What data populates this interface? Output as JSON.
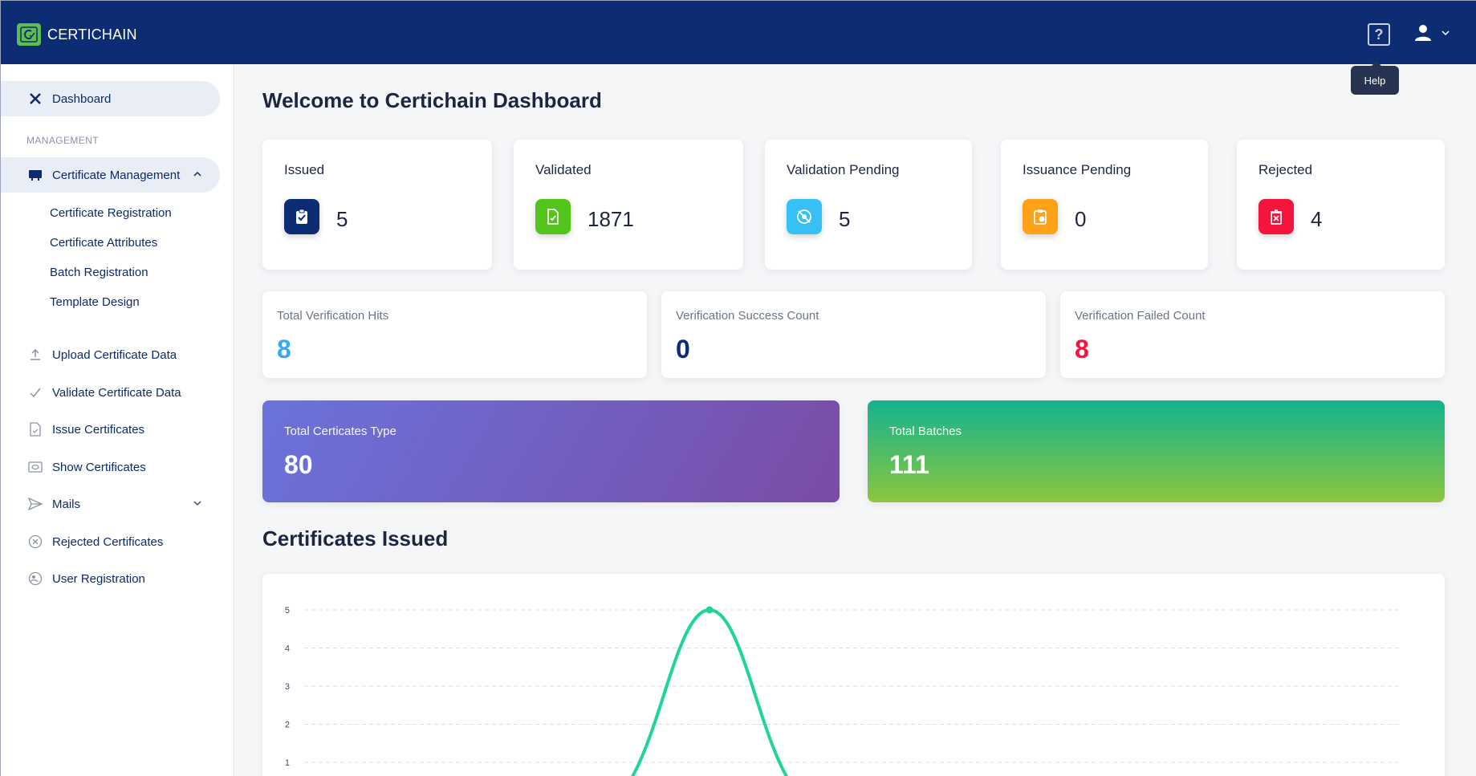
{
  "app": {
    "name": "CERTICHAIN",
    "help_tooltip": "Help",
    "help_glyph": "?"
  },
  "sidebar": {
    "dashboard": "Dashboard",
    "section_label": "MANAGEMENT",
    "cert_management": "Certificate Management",
    "sub_items": [
      "Certificate Registration",
      "Certificate Attributes",
      "Batch Registration",
      "Template Design"
    ],
    "items": [
      "Upload Certificate Data",
      "Validate Certificate Data",
      "Issue Certificates",
      "Show Certificates",
      "Mails",
      "Rejected Certificates",
      "User Registration"
    ]
  },
  "main": {
    "title": "Welcome to Certichain Dashboard",
    "stats": [
      {
        "label": "Issued",
        "value": "5",
        "color": "#0c2d74",
        "icon": "clipboard-check-icon"
      },
      {
        "label": "Validated",
        "value": "1871",
        "color": "#52c41a",
        "icon": "document-check-icon"
      },
      {
        "label": "Validation Pending",
        "value": "5",
        "color": "#36c0f5",
        "icon": "eye-off-icon"
      },
      {
        "label": "Issuance Pending",
        "value": "0",
        "color": "#ffa21a",
        "icon": "clipboard-clock-icon"
      },
      {
        "label": "Rejected",
        "value": "4",
        "color": "#f5153c",
        "icon": "trash-x-icon"
      }
    ],
    "verification": [
      {
        "label": "Total Verification Hits",
        "value": "8",
        "color": "#36a9f5"
      },
      {
        "label": "Verification Success Count",
        "value": "0",
        "color": "#0c2d74"
      },
      {
        "label": "Verification Failed Count",
        "value": "8",
        "color": "#f5153c"
      }
    ],
    "totals": [
      {
        "label": "Total Certicates Type",
        "value": "80"
      },
      {
        "label": "Total Batches",
        "value": "111"
      }
    ],
    "chart_title": "Certificates Issued"
  },
  "chart_data": {
    "type": "line",
    "title": "Certificates Issued",
    "yticks": [
      "1",
      "2",
      "3",
      "4",
      "5"
    ],
    "ylim": [
      0,
      5
    ],
    "series": [
      {
        "values": [
          0,
          5,
          0
        ],
        "color": "#1ed49a"
      }
    ],
    "grid": true
  }
}
